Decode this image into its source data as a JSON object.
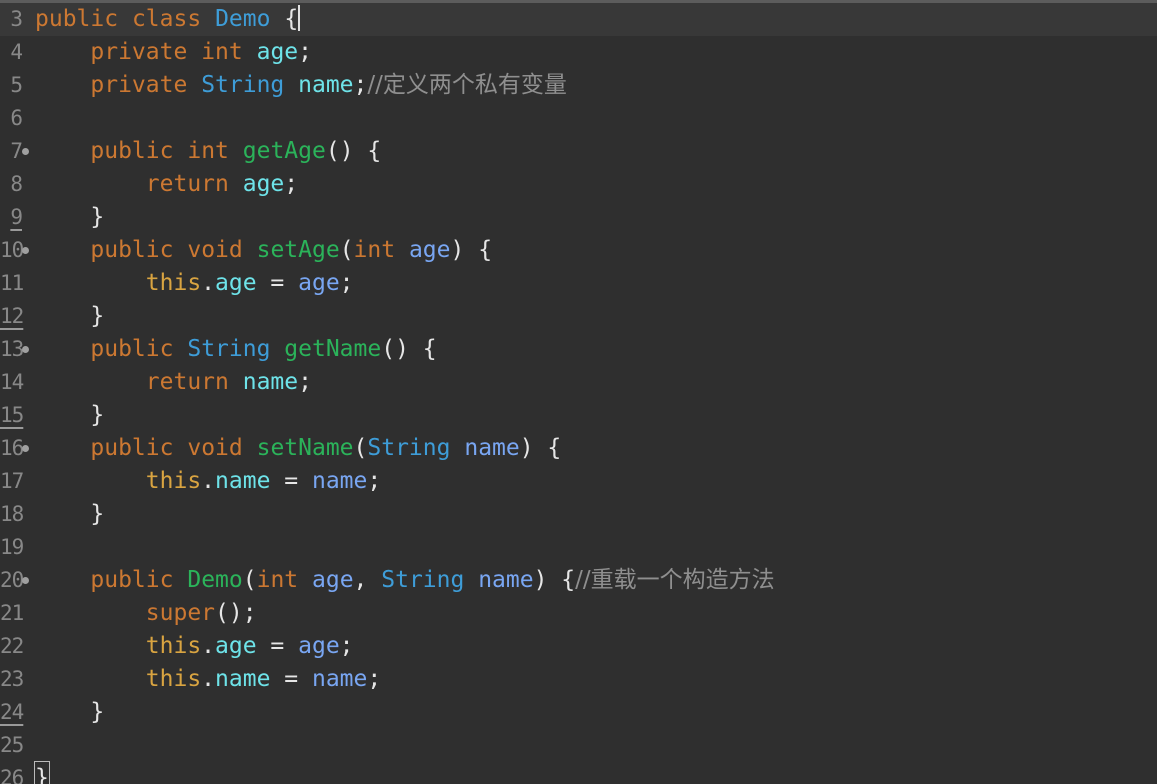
{
  "lines": [
    {
      "n": "3",
      "parts": [
        [
          "kw",
          "public"
        ],
        [
          "sp",
          " "
        ],
        [
          "kw",
          "class"
        ],
        [
          "sp",
          " "
        ],
        [
          "type",
          "Demo"
        ],
        [
          "sp",
          " "
        ],
        [
          "punc",
          "{"
        ]
      ]
    },
    {
      "n": "4",
      "parts": [
        [
          "sp",
          "    "
        ],
        [
          "kw",
          "private"
        ],
        [
          "sp",
          " "
        ],
        [
          "kw",
          "int"
        ],
        [
          "sp",
          " "
        ],
        [
          "fld",
          "age"
        ],
        [
          "punc",
          ";"
        ]
      ]
    },
    {
      "n": "5",
      "parts": [
        [
          "sp",
          "    "
        ],
        [
          "kw",
          "private"
        ],
        [
          "sp",
          " "
        ],
        [
          "type",
          "String"
        ],
        [
          "sp",
          " "
        ],
        [
          "fld",
          "name"
        ],
        [
          "punc",
          ";"
        ],
        [
          "cmt",
          "//定义两个私有变量"
        ]
      ]
    },
    {
      "n": "6",
      "parts": []
    },
    {
      "n": "7",
      "parts": [
        [
          "sp",
          "    "
        ],
        [
          "kw",
          "public"
        ],
        [
          "sp",
          " "
        ],
        [
          "kw",
          "int"
        ],
        [
          "sp",
          " "
        ],
        [
          "meth",
          "getAge"
        ],
        [
          "punc",
          "() {"
        ]
      ]
    },
    {
      "n": "8",
      "parts": [
        [
          "sp",
          "        "
        ],
        [
          "kw",
          "return"
        ],
        [
          "sp",
          " "
        ],
        [
          "fld",
          "age"
        ],
        [
          "punc",
          ";"
        ]
      ]
    },
    {
      "n": "9",
      "parts": [
        [
          "sp",
          "    "
        ],
        [
          "punc",
          "}"
        ]
      ]
    },
    {
      "n": "10",
      "parts": [
        [
          "sp",
          "    "
        ],
        [
          "kw",
          "public"
        ],
        [
          "sp",
          " "
        ],
        [
          "kw",
          "void"
        ],
        [
          "sp",
          " "
        ],
        [
          "meth",
          "setAge"
        ],
        [
          "punc",
          "("
        ],
        [
          "kw",
          "int"
        ],
        [
          "sp",
          " "
        ],
        [
          "param",
          "age"
        ],
        [
          "punc",
          ") {"
        ]
      ]
    },
    {
      "n": "11",
      "parts": [
        [
          "sp",
          "        "
        ],
        [
          "kw2",
          "this"
        ],
        [
          "punc",
          "."
        ],
        [
          "fld",
          "age"
        ],
        [
          "punc",
          " = "
        ],
        [
          "param",
          "age"
        ],
        [
          "punc",
          ";"
        ]
      ]
    },
    {
      "n": "12",
      "parts": [
        [
          "sp",
          "    "
        ],
        [
          "punc",
          "}"
        ]
      ]
    },
    {
      "n": "13",
      "parts": [
        [
          "sp",
          "    "
        ],
        [
          "kw",
          "public"
        ],
        [
          "sp",
          " "
        ],
        [
          "type",
          "String"
        ],
        [
          "sp",
          " "
        ],
        [
          "meth",
          "getName"
        ],
        [
          "punc",
          "() {"
        ]
      ]
    },
    {
      "n": "14",
      "parts": [
        [
          "sp",
          "        "
        ],
        [
          "kw",
          "return"
        ],
        [
          "sp",
          " "
        ],
        [
          "fld",
          "name"
        ],
        [
          "punc",
          ";"
        ]
      ]
    },
    {
      "n": "15",
      "parts": [
        [
          "sp",
          "    "
        ],
        [
          "punc",
          "}"
        ]
      ]
    },
    {
      "n": "16",
      "parts": [
        [
          "sp",
          "    "
        ],
        [
          "kw",
          "public"
        ],
        [
          "sp",
          " "
        ],
        [
          "kw",
          "void"
        ],
        [
          "sp",
          " "
        ],
        [
          "meth",
          "setName"
        ],
        [
          "punc",
          "("
        ],
        [
          "type",
          "String"
        ],
        [
          "sp",
          " "
        ],
        [
          "param",
          "name"
        ],
        [
          "punc",
          ") {"
        ]
      ]
    },
    {
      "n": "17",
      "parts": [
        [
          "sp",
          "        "
        ],
        [
          "kw2",
          "this"
        ],
        [
          "punc",
          "."
        ],
        [
          "fld",
          "name"
        ],
        [
          "punc",
          " = "
        ],
        [
          "param",
          "name"
        ],
        [
          "punc",
          ";"
        ]
      ]
    },
    {
      "n": "18",
      "parts": [
        [
          "sp",
          "    "
        ],
        [
          "punc",
          "}"
        ]
      ]
    },
    {
      "n": "19",
      "parts": []
    },
    {
      "n": "20",
      "parts": [
        [
          "sp",
          "    "
        ],
        [
          "kw",
          "public"
        ],
        [
          "sp",
          " "
        ],
        [
          "meth",
          "Demo"
        ],
        [
          "punc",
          "("
        ],
        [
          "kw",
          "int"
        ],
        [
          "sp",
          " "
        ],
        [
          "param",
          "age"
        ],
        [
          "punc",
          ", "
        ],
        [
          "type",
          "String"
        ],
        [
          "sp",
          " "
        ],
        [
          "param",
          "name"
        ],
        [
          "punc",
          ") {"
        ],
        [
          "cmt",
          "//重载一个构造方法"
        ]
      ]
    },
    {
      "n": "21",
      "parts": [
        [
          "sp",
          "        "
        ],
        [
          "kw",
          "super"
        ],
        [
          "punc",
          "();"
        ]
      ]
    },
    {
      "n": "22",
      "parts": [
        [
          "sp",
          "        "
        ],
        [
          "kw2",
          "this"
        ],
        [
          "punc",
          "."
        ],
        [
          "fld",
          "age"
        ],
        [
          "punc",
          " = "
        ],
        [
          "param",
          "age"
        ],
        [
          "punc",
          ";"
        ]
      ]
    },
    {
      "n": "23",
      "parts": [
        [
          "sp",
          "        "
        ],
        [
          "kw2",
          "this"
        ],
        [
          "punc",
          "."
        ],
        [
          "fld",
          "name"
        ],
        [
          "punc",
          " = "
        ],
        [
          "param",
          "name"
        ],
        [
          "punc",
          ";"
        ]
      ]
    },
    {
      "n": "24",
      "parts": [
        [
          "sp",
          "    "
        ],
        [
          "punc",
          "}"
        ]
      ]
    },
    {
      "n": "25",
      "parts": []
    },
    {
      "n": "26",
      "parts": [
        [
          "brace",
          "}"
        ]
      ]
    }
  ],
  "folding_lines": [
    "7",
    "10",
    "13",
    "16",
    "20"
  ],
  "marked_lines": [
    "9",
    "12",
    "15",
    "24"
  ],
  "current_line": "3",
  "colors": {
    "background": "#2f2f2f",
    "keyword": "#cc7832",
    "this_keyword": "#d9a441",
    "type": "#3e9dd8",
    "field": "#6ee3e9",
    "parameter": "#79a6f2",
    "method": "#2bb35a",
    "comment": "#8f8f8f",
    "line_number": "#888888"
  }
}
